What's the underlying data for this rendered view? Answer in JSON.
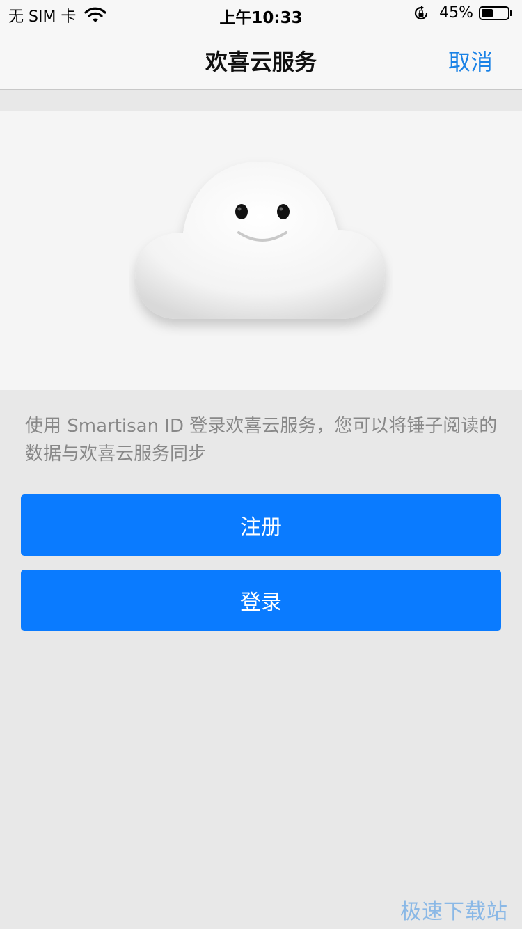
{
  "status_bar": {
    "carrier": "无 SIM 卡",
    "time": "上午10:33",
    "battery_percent": "45%",
    "battery_level": 0.45,
    "icons": [
      "wifi-icon",
      "rotation-lock-icon",
      "battery-icon"
    ]
  },
  "nav": {
    "title": "欢喜云服务",
    "cancel_label": "取消"
  },
  "hero": {
    "illustration": "cloud-mascot-icon"
  },
  "description": "使用 Smartisan ID 登录欢喜云服务，您可以将锤子阅读的数据与欢喜云服务同步",
  "buttons": {
    "register_label": "注册",
    "login_label": "登录"
  },
  "watermark": "极速下载站",
  "colors": {
    "accent": "#0a7bff",
    "nav_link": "#1a82e6",
    "background": "#e8e8e8"
  }
}
